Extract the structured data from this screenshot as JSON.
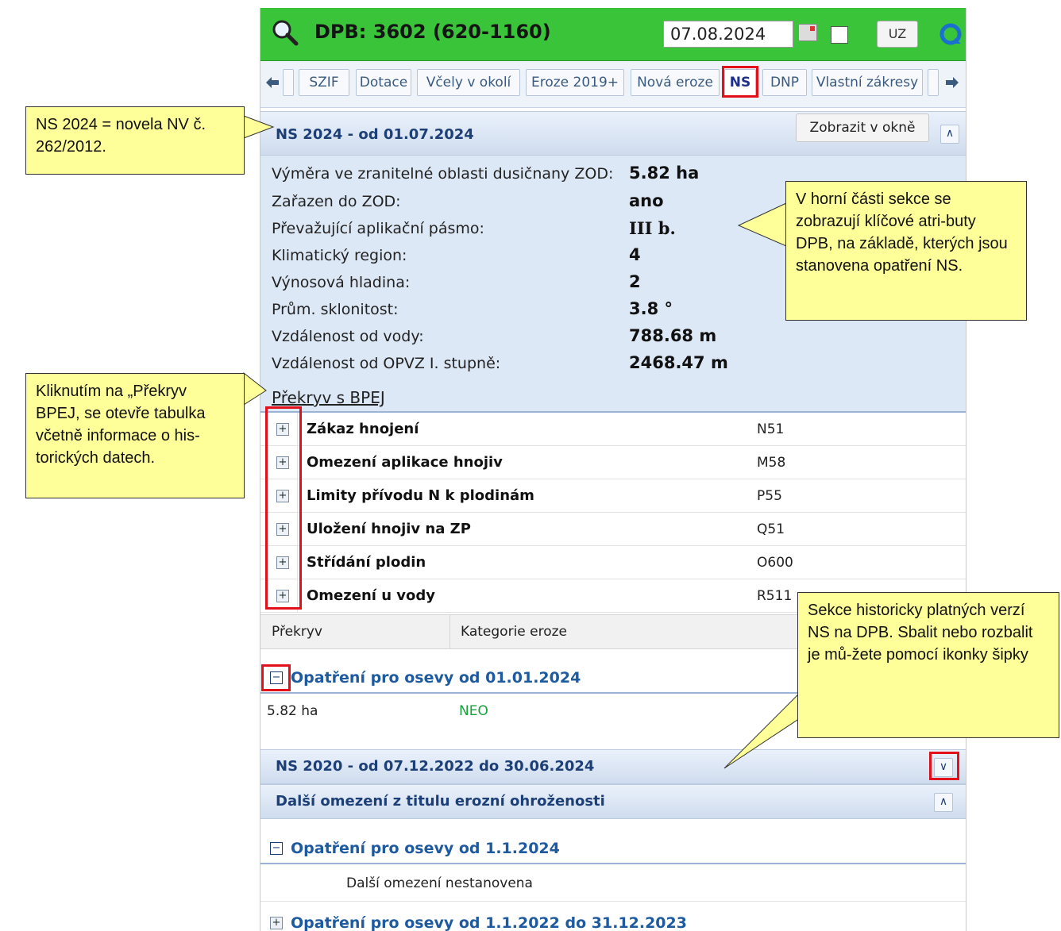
{
  "titlebar": {
    "title": "DPB: 3602 (620-1160)",
    "date": "07.08.2024",
    "uz_label": "UZ"
  },
  "tabs": [
    "SZIF",
    "Dotace",
    "Včely v okolí",
    "Eroze 2019+",
    "Nová eroze",
    "NS",
    "DNP",
    "Vlastní zákresy"
  ],
  "active_tab": "NS",
  "section_ns2024": {
    "title": "NS 2024 - od 01.07.2024",
    "button": "Zobrazit v okně"
  },
  "attributes": [
    {
      "label": "Výměra ve zranitelné oblasti dusičnany ZOD:",
      "value": "5.82 ha"
    },
    {
      "label": "Zařazen do ZOD:",
      "value": "ano"
    },
    {
      "label": "Převažující aplikační pásmo:",
      "value": "III b."
    },
    {
      "label": "Klimatický region:",
      "value": "4"
    },
    {
      "label": "Výnosová hladina:",
      "value": "2"
    },
    {
      "label": "Prům. sklonitost:",
      "value": "3.8 °"
    },
    {
      "label": "Vzdálenost od vody:",
      "value": "788.68 m"
    },
    {
      "label": "Vzdálenost od OPVZ I. stupně:",
      "value": "2468.47 m"
    }
  ],
  "overlap_link": "Překryv s BPEJ",
  "measures": [
    {
      "label": "Zákaz hnojení",
      "code": "N51"
    },
    {
      "label": "Omezení aplikace hnojiv",
      "code": "M58"
    },
    {
      "label": "Limity přívodu N k plodinám",
      "code": "P55"
    },
    {
      "label": "Uložení hnojiv na ZP",
      "code": "Q51"
    },
    {
      "label": "Střídání plodin",
      "code": "O600"
    },
    {
      "label": "Omezení u vody",
      "code": "R511"
    }
  ],
  "grid": {
    "col1": "Překryv",
    "col2": "Kategorie eroze"
  },
  "crops_2024": {
    "title": "Opatření pro osevy od 01.01.2024",
    "area": "5.82 ha",
    "category": "NEO"
  },
  "section_ns2020": {
    "title": "NS 2020 - od 07.12.2022 do 30.06.2024"
  },
  "section_erosion": {
    "title": "Další omezení z titulu erozní ohroženosti"
  },
  "crops_2024b": {
    "title": "Opatření pro osevy od 1.1.2024",
    "note": "Další omezení nestanovena"
  },
  "crops_2022": {
    "title": "Opatření pro osevy od 1.1.2022 do 31.12.2023"
  },
  "callouts": {
    "ns2024": "NS 2024 = novela NV č. 262/2012.",
    "attrs": "V horní části sekce se zobrazují klíčové atri-buty DPB, na základě, kterých jsou stanovena opatření NS.",
    "bpej": "Kliknutím na „Překryv BPEJ, se otevře tabulka včetně informace o his-torických datech.",
    "history": "Sekce historicky platných verzí NS na DPB. Sbalit nebo rozbalit je mů-žete pomocí ikonky šipky"
  }
}
